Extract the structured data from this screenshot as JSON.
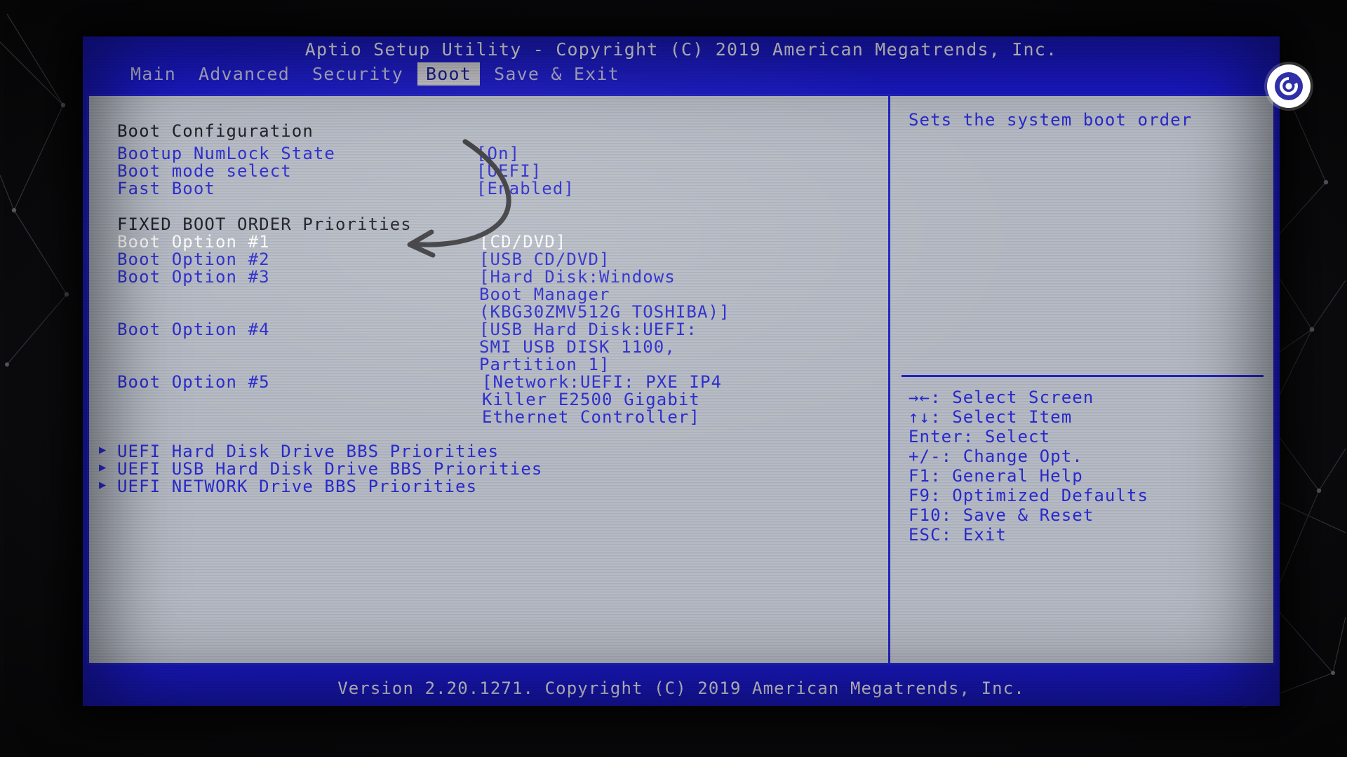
{
  "window": {
    "title": "Aptio Setup Utility - Copyright (C) 2019 American Megatrends, Inc.",
    "footer": "Version 2.20.1271. Copyright (C) 2019 American Megatrends, Inc."
  },
  "tabs": [
    {
      "label": "Main",
      "active": false
    },
    {
      "label": "Advanced",
      "active": false
    },
    {
      "label": "Security",
      "active": false
    },
    {
      "label": "Boot",
      "active": true
    },
    {
      "label": "Save & Exit",
      "active": false
    }
  ],
  "main": {
    "section_boot_config": "Boot Configuration",
    "settings": [
      {
        "label": "Bootup NumLock State",
        "value": "[On]"
      },
      {
        "label": "Boot mode select",
        "value": "[UEFI]"
      },
      {
        "label": "Fast Boot",
        "value": "[Enabled]"
      }
    ],
    "section_fixed_order": "FIXED BOOT ORDER Priorities",
    "boot_options": [
      {
        "label": "Boot Option #1",
        "value_lines": [
          "[CD/DVD]"
        ],
        "selected": true
      },
      {
        "label": "Boot Option #2",
        "value_lines": [
          "[USB CD/DVD]"
        ],
        "selected": false
      },
      {
        "label": "Boot Option #3",
        "value_lines": [
          "[Hard Disk:Windows",
          "Boot Manager",
          "(KBG30ZMV512G TOSHIBA)]"
        ],
        "selected": false
      },
      {
        "label": "Boot Option #4",
        "value_lines": [
          "[USB Hard Disk:UEFI:",
          "SMI USB DISK 1100,",
          "Partition 1]"
        ],
        "selected": false
      },
      {
        "label": "Boot Option #5",
        "value_lines": [
          "[Network:UEFI: PXE IP4",
          "Killer E2500 Gigabit",
          "Ethernet Controller]"
        ],
        "selected": false
      }
    ],
    "submenus": [
      "UEFI Hard Disk Drive BBS Priorities",
      "UEFI USB Hard Disk Drive BBS Priorities",
      "UEFI NETWORK Drive BBS Priorities"
    ],
    "submenu_marker": "▶"
  },
  "help": {
    "text": "Sets the system boot order",
    "keys": [
      "→←: Select Screen",
      "↑↓: Select Item",
      "Enter: Select",
      "+/-: Change Opt.",
      "F1: General Help",
      "F9: Optimized Defaults",
      "F10: Save & Reset",
      "ESC: Exit"
    ]
  },
  "colors": {
    "screen_blue": "#1a19c9",
    "panel_gray": "#b5bac4",
    "text_blue": "#2a2ad0",
    "text_black": "#1b1b24",
    "text_selected": "#ffffff",
    "tab_active_bg": "#c9c9cf"
  }
}
